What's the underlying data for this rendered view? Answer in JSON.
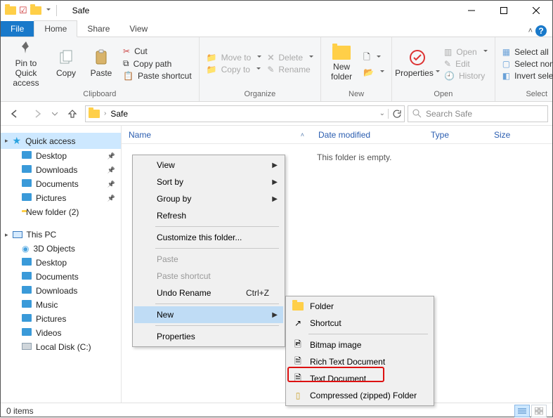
{
  "window": {
    "title": "Safe"
  },
  "tabs": {
    "file": "File",
    "home": "Home",
    "share": "Share",
    "view": "View"
  },
  "ribbon": {
    "clipboard": {
      "label": "Clipboard",
      "pin": "Pin to Quick access",
      "copy": "Copy",
      "paste": "Paste",
      "cut": "Cut",
      "copypath": "Copy path",
      "pasteshort": "Paste shortcut"
    },
    "organize": {
      "label": "Organize",
      "moveto": "Move to",
      "copyto": "Copy to",
      "delete": "Delete",
      "rename": "Rename"
    },
    "new": {
      "label": "New",
      "newfolder": "New folder"
    },
    "open": {
      "label": "Open",
      "properties": "Properties",
      "open": "Open",
      "edit": "Edit",
      "history": "History"
    },
    "select": {
      "label": "Select",
      "all": "Select all",
      "none": "Select none",
      "invert": "Invert selection"
    }
  },
  "address": {
    "path": "Safe",
    "search_ph": "Search Safe"
  },
  "columns": {
    "name": "Name",
    "mod": "Date modified",
    "type": "Type",
    "size": "Size"
  },
  "nav": {
    "quick": "Quick access",
    "items1": [
      {
        "label": "Desktop",
        "pin": true
      },
      {
        "label": "Downloads",
        "pin": true
      },
      {
        "label": "Documents",
        "pin": true
      },
      {
        "label": "Pictures",
        "pin": true
      },
      {
        "label": "New folder (2)",
        "pin": false
      }
    ],
    "thispc": "This PC",
    "items2": [
      {
        "label": "3D Objects"
      },
      {
        "label": "Desktop"
      },
      {
        "label": "Documents"
      },
      {
        "label": "Downloads"
      },
      {
        "label": "Music"
      },
      {
        "label": "Pictures"
      },
      {
        "label": "Videos"
      },
      {
        "label": "Local Disk (C:)"
      }
    ]
  },
  "empty_msg": "This folder is empty.",
  "ctx": {
    "view": "View",
    "sortby": "Sort by",
    "groupby": "Group by",
    "refresh": "Refresh",
    "customize": "Customize this folder...",
    "paste": "Paste",
    "pasteshort": "Paste shortcut",
    "undo": "Undo Rename",
    "undo_key": "Ctrl+Z",
    "new": "New",
    "properties": "Properties"
  },
  "submenu": {
    "folder": "Folder",
    "shortcut": "Shortcut",
    "bitmap": "Bitmap image",
    "rtf": "Rich Text Document",
    "txt": "Text Document",
    "zip": "Compressed (zipped) Folder"
  },
  "status": {
    "items": "0 items"
  }
}
